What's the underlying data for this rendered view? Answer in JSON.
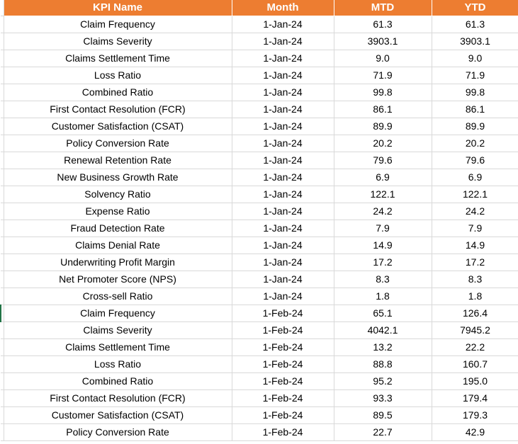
{
  "headers": [
    "KPI Name",
    "Month",
    "MTD",
    "YTD"
  ],
  "rows": [
    [
      "Claim Frequency",
      "1-Jan-24",
      "61.3",
      "61.3"
    ],
    [
      "Claims Severity",
      "1-Jan-24",
      "3903.1",
      "3903.1"
    ],
    [
      "Claims Settlement Time",
      "1-Jan-24",
      "9.0",
      "9.0"
    ],
    [
      "Loss Ratio",
      "1-Jan-24",
      "71.9",
      "71.9"
    ],
    [
      "Combined Ratio",
      "1-Jan-24",
      "99.8",
      "99.8"
    ],
    [
      "First Contact Resolution (FCR)",
      "1-Jan-24",
      "86.1",
      "86.1"
    ],
    [
      "Customer Satisfaction (CSAT)",
      "1-Jan-24",
      "89.9",
      "89.9"
    ],
    [
      "Policy Conversion Rate",
      "1-Jan-24",
      "20.2",
      "20.2"
    ],
    [
      "Renewal Retention Rate",
      "1-Jan-24",
      "79.6",
      "79.6"
    ],
    [
      "New Business Growth Rate",
      "1-Jan-24",
      "6.9",
      "6.9"
    ],
    [
      "Solvency Ratio",
      "1-Jan-24",
      "122.1",
      "122.1"
    ],
    [
      "Expense Ratio",
      "1-Jan-24",
      "24.2",
      "24.2"
    ],
    [
      "Fraud Detection Rate",
      "1-Jan-24",
      "7.9",
      "7.9"
    ],
    [
      "Claims Denial Rate",
      "1-Jan-24",
      "14.9",
      "14.9"
    ],
    [
      "Underwriting Profit Margin",
      "1-Jan-24",
      "17.2",
      "17.2"
    ],
    [
      "Net Promoter Score (NPS)",
      "1-Jan-24",
      "8.3",
      "8.3"
    ],
    [
      "Cross-sell Ratio",
      "1-Jan-24",
      "1.8",
      "1.8"
    ],
    [
      "Claim Frequency",
      "1-Feb-24",
      "65.1",
      "126.4"
    ],
    [
      "Claims Severity",
      "1-Feb-24",
      "4042.1",
      "7945.2"
    ],
    [
      "Claims Settlement Time",
      "1-Feb-24",
      "13.2",
      "22.2"
    ],
    [
      "Loss Ratio",
      "1-Feb-24",
      "88.8",
      "160.7"
    ],
    [
      "Combined Ratio",
      "1-Feb-24",
      "95.2",
      "195.0"
    ],
    [
      "First Contact Resolution (FCR)",
      "1-Feb-24",
      "93.3",
      "179.4"
    ],
    [
      "Customer Satisfaction (CSAT)",
      "1-Feb-24",
      "89.5",
      "179.3"
    ],
    [
      "Policy Conversion Rate",
      "1-Feb-24",
      "22.7",
      "42.9"
    ]
  ],
  "selected_row_index": 17,
  "colors": {
    "header_bg": "#ED7D31",
    "header_text": "#FFFFFF",
    "grid": "#D9D9D9",
    "selection": "#217346"
  }
}
